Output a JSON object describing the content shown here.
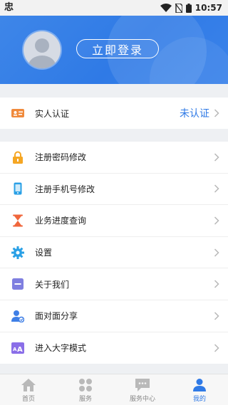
{
  "statusbar": {
    "time": "10:57",
    "app_glyph": "忠"
  },
  "header": {
    "login_label": "立即登录"
  },
  "auth": {
    "label": "实人认证",
    "status": "未认证"
  },
  "menu": {
    "items": [
      {
        "label": "注册密码修改",
        "icon": "lock-icon"
      },
      {
        "label": "注册手机号修改",
        "icon": "phone-icon"
      },
      {
        "label": "业务进度查询",
        "icon": "hourglass-icon"
      },
      {
        "label": "设置",
        "icon": "gear-icon"
      },
      {
        "label": "关于我们",
        "icon": "minus-square-icon"
      },
      {
        "label": "面对面分享",
        "icon": "share-user-icon"
      },
      {
        "label": "进入大字模式",
        "icon": "font-size-icon"
      }
    ]
  },
  "tabs": [
    {
      "label": "首页",
      "icon": "home-icon",
      "active": false
    },
    {
      "label": "服务",
      "icon": "grid-icon",
      "active": false
    },
    {
      "label": "服务中心",
      "icon": "chat-icon",
      "active": false
    },
    {
      "label": "我的",
      "icon": "user-icon",
      "active": true
    }
  ],
  "colors": {
    "accent": "#2f7ae6",
    "header_bg": "#3580e8",
    "page_bg": "#eef0f3"
  }
}
